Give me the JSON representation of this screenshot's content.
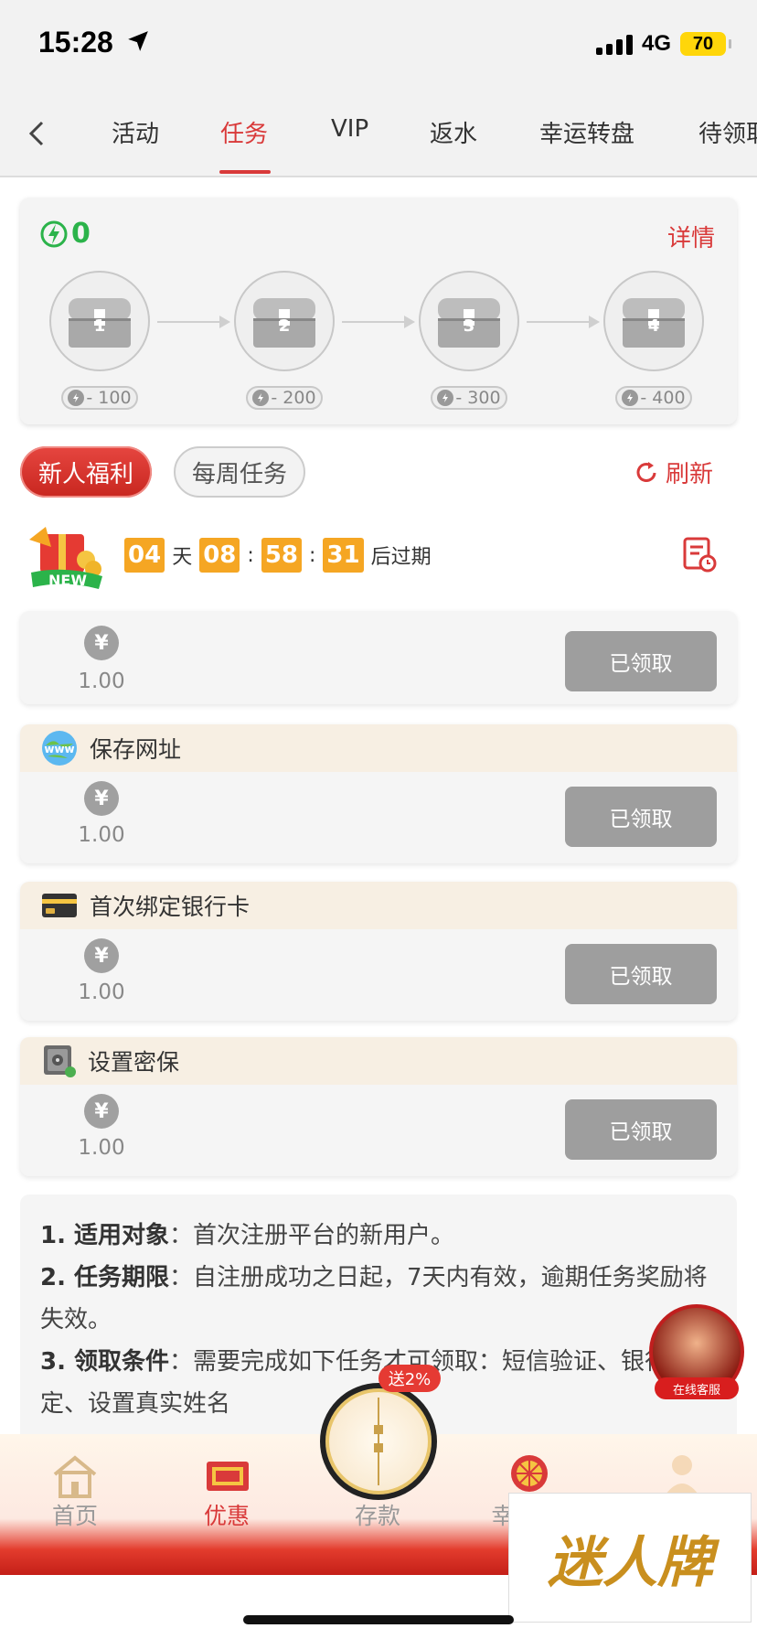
{
  "status_bar": {
    "time": "15:28",
    "network": "4G",
    "battery": "70"
  },
  "tabs": [
    {
      "label": "活动"
    },
    {
      "label": "任务",
      "active": true
    },
    {
      "label": "VIP"
    },
    {
      "label": "返水"
    },
    {
      "label": "幸运转盘"
    },
    {
      "label": "待领取"
    }
  ],
  "energy": {
    "value": "0"
  },
  "detail_link": "详情",
  "chests": [
    {
      "num": "1",
      "cost": "- 100"
    },
    {
      "num": "2",
      "cost": "- 200"
    },
    {
      "num": "3",
      "cost": "- 300"
    },
    {
      "num": "4",
      "cost": "- 400"
    }
  ],
  "subtabs": {
    "active": "新人福利",
    "inactive": "每周任务",
    "refresh": "刷新"
  },
  "countdown": {
    "days": "04",
    "day_unit": "天",
    "hours": "08",
    "sep": ":",
    "minutes": "58",
    "seconds": "31",
    "suffix": "后过期",
    "badge": "NEW"
  },
  "tasks": [
    {
      "title": "",
      "amount": "1.00",
      "button": "已领取",
      "currency": "¥"
    },
    {
      "title": "保存网址",
      "amount": "1.00",
      "button": "已领取",
      "currency": "¥",
      "icon": "globe-icon"
    },
    {
      "title": "首次绑定银行卡",
      "amount": "1.00",
      "button": "已领取",
      "currency": "¥",
      "icon": "bank-card-icon"
    },
    {
      "title": "设置密保",
      "amount": "1.00",
      "button": "已领取",
      "currency": "¥",
      "icon": "safe-icon"
    }
  ],
  "rules": {
    "r1_label": "1. 适用对象",
    "r1_text": "：首次注册平台的新用户。",
    "r2_label": "2. 任务期限",
    "r2_text": "：自注册成功之日起，7天内有效，逾期任务奖励将失效。",
    "r3_label": "3. 领取条件",
    "r3_text": "：需要完成如下任务才可领取：短信验证、银行卡绑定、设置真实姓名",
    "www": "www"
  },
  "floating": {
    "customer_service": "在线客服",
    "gift_badge": "送2%"
  },
  "bottom_nav": {
    "home": "首页",
    "promo": "优惠",
    "deposit": "存款",
    "lucky": "幸",
    "watermark": "迷人牌"
  },
  "colors": {
    "accent": "#d93a3a",
    "energy": "#2bb34a",
    "timer": "#f5a623",
    "button_disabled": "#9e9e9e"
  }
}
